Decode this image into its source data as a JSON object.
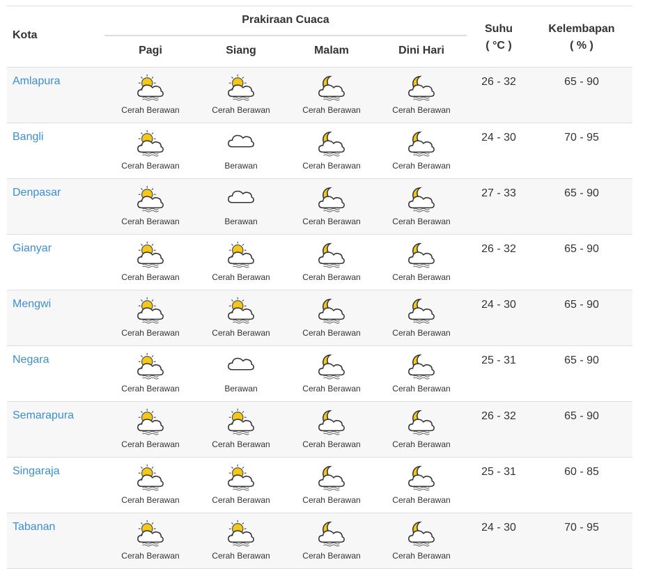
{
  "header": {
    "kota": "Kota",
    "prakiraan": "Prakiraan Cuaca",
    "periods": [
      "Pagi",
      "Siang",
      "Malam",
      "Dini Hari"
    ],
    "suhu": "Suhu",
    "suhu_unit": "( °C )",
    "kelembapan": "Kelembapan",
    "kelembapan_unit": "( % )"
  },
  "colors": {
    "link": "#3b8ed6",
    "text": "#333333",
    "rule": "#dddddd",
    "alt_row": "#f7f7f7",
    "sun": "#f2c81a",
    "moon": "#f2c81a"
  },
  "icons": {
    "Cerah Berawan": "partly-cloudy-day-icon",
    "Berawan": "cloud-icon",
    "Cerah Berawan (night)": "partly-cloudy-night-icon"
  },
  "rows": [
    {
      "city": "Amlapura",
      "forecast": [
        {
          "label": "Cerah Berawan",
          "icon": "day"
        },
        {
          "label": "Cerah Berawan",
          "icon": "day"
        },
        {
          "label": "Cerah Berawan",
          "icon": "night"
        },
        {
          "label": "Cerah Berawan",
          "icon": "night"
        }
      ],
      "temp": "26 - 32",
      "humidity": "65 - 90"
    },
    {
      "city": "Bangli",
      "forecast": [
        {
          "label": "Cerah Berawan",
          "icon": "day"
        },
        {
          "label": "Berawan",
          "icon": "cloud"
        },
        {
          "label": "Cerah Berawan",
          "icon": "night"
        },
        {
          "label": "Cerah Berawan",
          "icon": "night"
        }
      ],
      "temp": "24 - 30",
      "humidity": "70 - 95"
    },
    {
      "city": "Denpasar",
      "forecast": [
        {
          "label": "Cerah Berawan",
          "icon": "day"
        },
        {
          "label": "Berawan",
          "icon": "cloud"
        },
        {
          "label": "Cerah Berawan",
          "icon": "night"
        },
        {
          "label": "Cerah Berawan",
          "icon": "night"
        }
      ],
      "temp": "27 - 33",
      "humidity": "65 - 90"
    },
    {
      "city": "Gianyar",
      "forecast": [
        {
          "label": "Cerah Berawan",
          "icon": "day"
        },
        {
          "label": "Cerah Berawan",
          "icon": "day"
        },
        {
          "label": "Cerah Berawan",
          "icon": "night"
        },
        {
          "label": "Cerah Berawan",
          "icon": "night"
        }
      ],
      "temp": "26 - 32",
      "humidity": "65 - 90"
    },
    {
      "city": "Mengwi",
      "forecast": [
        {
          "label": "Cerah Berawan",
          "icon": "day"
        },
        {
          "label": "Cerah Berawan",
          "icon": "day"
        },
        {
          "label": "Cerah Berawan",
          "icon": "night"
        },
        {
          "label": "Cerah Berawan",
          "icon": "night"
        }
      ],
      "temp": "24 - 30",
      "humidity": "65 - 90"
    },
    {
      "city": "Negara",
      "forecast": [
        {
          "label": "Cerah Berawan",
          "icon": "day"
        },
        {
          "label": "Berawan",
          "icon": "cloud"
        },
        {
          "label": "Cerah Berawan",
          "icon": "night"
        },
        {
          "label": "Cerah Berawan",
          "icon": "night"
        }
      ],
      "temp": "25 - 31",
      "humidity": "65 - 90"
    },
    {
      "city": "Semarapura",
      "forecast": [
        {
          "label": "Cerah Berawan",
          "icon": "day"
        },
        {
          "label": "Cerah Berawan",
          "icon": "day"
        },
        {
          "label": "Cerah Berawan",
          "icon": "night"
        },
        {
          "label": "Cerah Berawan",
          "icon": "night"
        }
      ],
      "temp": "26 - 32",
      "humidity": "65 - 90"
    },
    {
      "city": "Singaraja",
      "forecast": [
        {
          "label": "Cerah Berawan",
          "icon": "day"
        },
        {
          "label": "Cerah Berawan",
          "icon": "day"
        },
        {
          "label": "Cerah Berawan",
          "icon": "night"
        },
        {
          "label": "Cerah Berawan",
          "icon": "night"
        }
      ],
      "temp": "25 - 31",
      "humidity": "60 - 85"
    },
    {
      "city": "Tabanan",
      "forecast": [
        {
          "label": "Cerah Berawan",
          "icon": "day"
        },
        {
          "label": "Cerah Berawan",
          "icon": "day"
        },
        {
          "label": "Cerah Berawan",
          "icon": "night"
        },
        {
          "label": "Cerah Berawan",
          "icon": "night"
        }
      ],
      "temp": "24 - 30",
      "humidity": "70 - 95"
    }
  ]
}
